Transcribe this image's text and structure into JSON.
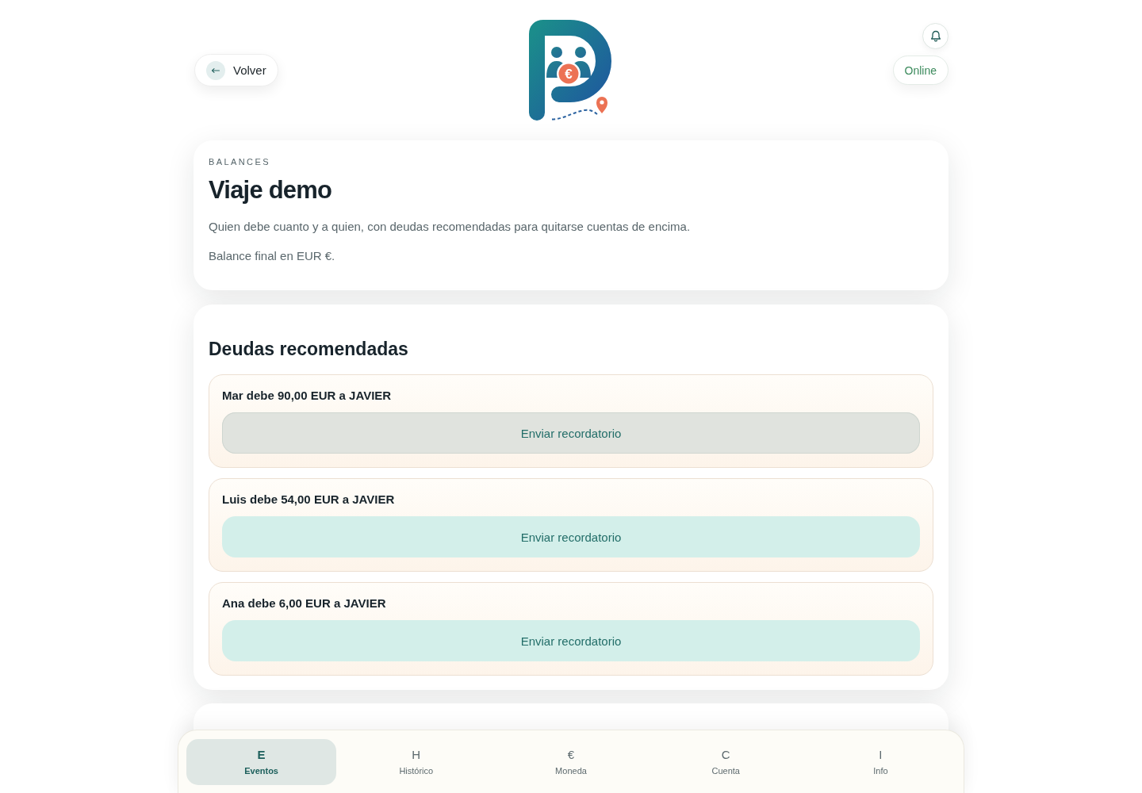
{
  "header": {
    "back_button": {
      "label": "Volver"
    },
    "logo": {
      "symbol": "€"
    },
    "status": {
      "label": "Online"
    }
  },
  "summary": {
    "eyebrow": "BALANCES",
    "title": "Viaje demo",
    "description": "Quien debe cuanto y a quien, con deudas recomendadas para quitarse cuentas de encima.",
    "note": "Balance final en EUR €."
  },
  "debts_section": {
    "title": "Deudas recomendadas",
    "debts": [
      {
        "text": "Mar debe 90,00 EUR a JAVIER",
        "action": "Enviar recordatorio",
        "highlighted": true
      },
      {
        "text": "Luis debe 54,00 EUR a JAVIER",
        "action": "Enviar recordatorio",
        "highlighted": false
      },
      {
        "text": "Ana debe 6,00 EUR a JAVIER",
        "action": "Enviar recordatorio",
        "highlighted": false
      }
    ]
  },
  "bottom_nav": [
    {
      "glyph": "E",
      "label": "Eventos",
      "selected": true
    },
    {
      "glyph": "H",
      "label": "Histórico",
      "selected": false
    },
    {
      "glyph": "€",
      "label": "Moneda",
      "selected": false
    },
    {
      "glyph": "C",
      "label": "Cuenta",
      "selected": false
    },
    {
      "glyph": "I",
      "label": "Info",
      "selected": false
    }
  ]
}
